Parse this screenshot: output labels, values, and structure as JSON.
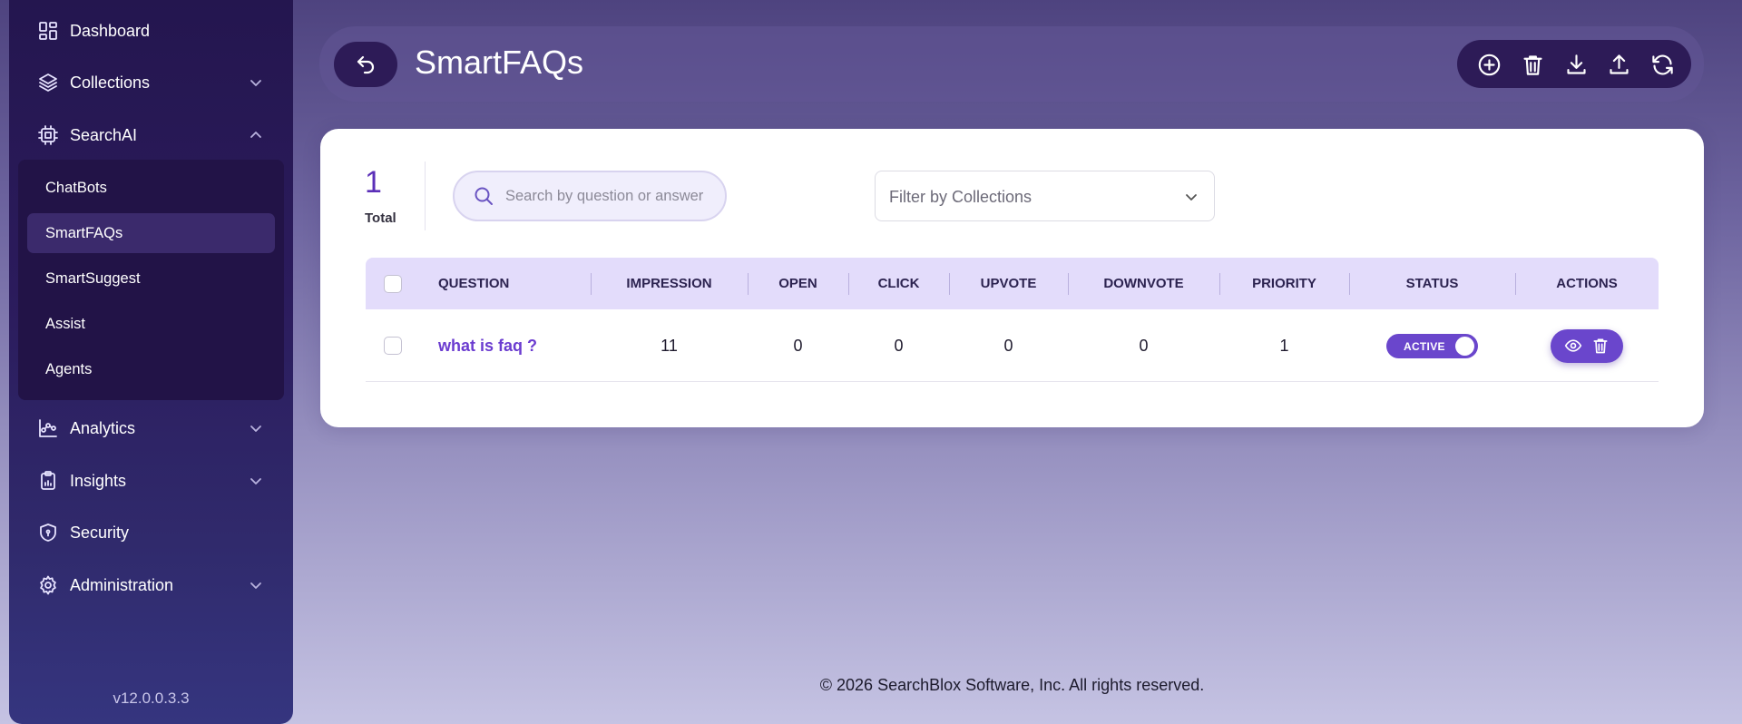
{
  "sidebar": {
    "items": [
      {
        "label": "Dashboard",
        "icon": "dashboard-icon"
      },
      {
        "label": "Collections",
        "icon": "layers-icon"
      },
      {
        "label": "SearchAI",
        "icon": "cpu-icon"
      },
      {
        "label": "Analytics",
        "icon": "analytics-icon"
      },
      {
        "label": "Insights",
        "icon": "clipboard-chart-icon"
      },
      {
        "label": "Security",
        "icon": "shield-icon"
      },
      {
        "label": "Administration",
        "icon": "gear-icon"
      }
    ],
    "searchai_submenu": [
      "ChatBots",
      "SmartFAQs",
      "SmartSuggest",
      "Assist",
      "Agents"
    ],
    "active_subitem": "SmartFAQs",
    "version": "v12.0.0.3.3"
  },
  "header": {
    "title": "SmartFAQs",
    "toolbar_icons": [
      "add-icon",
      "trash-icon",
      "download-icon",
      "upload-icon",
      "refresh-icon"
    ]
  },
  "summary": {
    "total_count": "1",
    "total_label": "Total"
  },
  "search": {
    "placeholder": "Search by question or answer"
  },
  "filter": {
    "label": "Filter by Collections"
  },
  "table": {
    "columns": [
      "QUESTION",
      "IMPRESSION",
      "OPEN",
      "CLICK",
      "UPVOTE",
      "DOWNVOTE",
      "PRIORITY",
      "STATUS",
      "ACTIONS"
    ],
    "rows": [
      {
        "question": "what is faq ?",
        "impression": "11",
        "open": "0",
        "click": "0",
        "upvote": "0",
        "downvote": "0",
        "priority": "1",
        "status": "ACTIVE"
      }
    ]
  },
  "footer": {
    "text": "© 2026 SearchBlox Software, Inc. All rights reserved."
  },
  "colors": {
    "accent": "#6a46cc",
    "sidebar_bg": "#24164f",
    "header_dark": "#2d1b57",
    "table_header_bg": "#e3dcfb"
  }
}
